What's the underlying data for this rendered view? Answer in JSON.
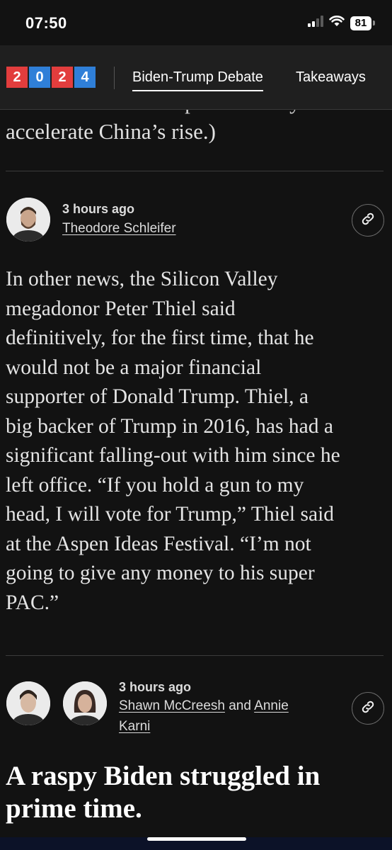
{
  "status_bar": {
    "time": "07:50",
    "battery": "81",
    "icons": [
      "cellular-signal-icon",
      "wifi-icon",
      "battery-icon"
    ]
  },
  "nav": {
    "logo": {
      "digits": [
        "2",
        "0",
        "2",
        "4"
      ],
      "colors": [
        "#e23d3d",
        "#2f7fd8",
        "#e23d3d",
        "#2f7fd8"
      ]
    },
    "links": [
      {
        "label": "Biden-Trump Debate",
        "active": true
      },
      {
        "label": "Takeaways",
        "active": false
      }
    ]
  },
  "previous_post": {
    "cut_line": "believe his leadership would only",
    "last_line": "accelerate China’s rise.)"
  },
  "post1": {
    "time": "3 hours ago",
    "author": "Theodore Schleifer",
    "body_lines": [
      "In other news, the Silicon Valley",
      "megadonor Peter Thiel said",
      "definitively, for the first time, that he",
      "would not be a major financial",
      "supporter of Donald Trump. Thiel, a",
      "big backer of Trump in 2016, has had a",
      "significant falling-out with him since he",
      "left office. “If you hold a gun to my",
      "head, I will vote for Trump,” Thiel said",
      "at the Aspen Ideas Festival. “I’m not",
      "going to give any money to his super",
      "PAC.”"
    ]
  },
  "post2": {
    "time": "3 hours ago",
    "author1": "Shawn McCreesh",
    "connector": "and",
    "author2_line1": "Annie",
    "author2_line2": "Karni",
    "headline_lines": [
      "A raspy Biden struggled in",
      "prime time."
    ]
  },
  "colors": {
    "background": "#121212",
    "nav_background": "#1f1f1f",
    "text": "#e4e4e4",
    "divider": "#3c3c3c"
  }
}
